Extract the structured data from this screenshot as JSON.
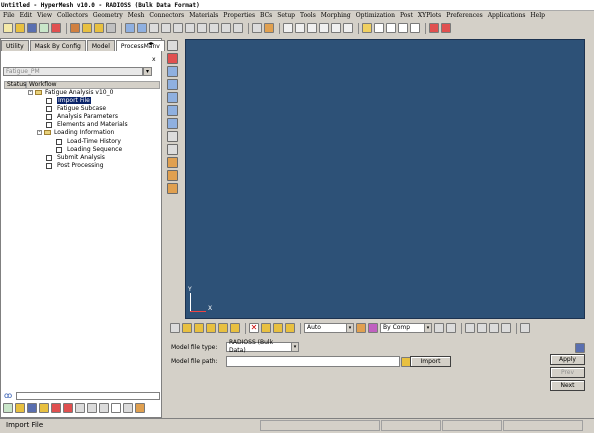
{
  "window": {
    "title": "Untitled - HyperMesh v10.0 - RADIOSS (Bulk Data Format)"
  },
  "menu": [
    "File",
    "Edit",
    "View",
    "Collectors",
    "Geometry",
    "Mesh",
    "Connectors",
    "Materials",
    "Properties",
    "BCs",
    "Setup",
    "Tools",
    "Morphing",
    "Optimization",
    "Post",
    "XYPlots",
    "Preferences",
    "Applications",
    "Help"
  ],
  "tabs": [
    "Utility",
    "Mask By Config",
    "Model",
    "ProcessManv"
  ],
  "active_tab": "ProcessManv",
  "process_field": "Fatigue_PM",
  "tree": {
    "columns": [
      "Status",
      "Workflow"
    ],
    "root": "Fatigue Analysis v10_0",
    "items": {
      "import_file": "Import File",
      "fatigue_subcase": "Fatigue Subcase",
      "analysis_parameters": "Analysis Parameters",
      "elements_materials": "Elements and Materials",
      "loading_information": "Loading Information",
      "load_time_history": "Load-Time History",
      "loading_sequence": "Loading Sequence",
      "submit_analysis": "Submit Analysis",
      "post_processing": "Post Processing"
    }
  },
  "viewport": {
    "background": "#2d5177",
    "axis_y": "Y",
    "axis_x": "X"
  },
  "bottom_toolbar": {
    "auto_combo": "Auto",
    "comp_combo": "By Comp"
  },
  "form": {
    "model_file_type_label": "Model file type:",
    "model_file_type_value": "RADIOSS (Bulk Data)",
    "model_file_path_label": "Model file path:",
    "model_file_path_value": "",
    "import_button": "Import"
  },
  "nav_buttons": {
    "apply": "Apply",
    "prev": "Prev",
    "next": "Next"
  },
  "status": {
    "text": "Import File"
  }
}
